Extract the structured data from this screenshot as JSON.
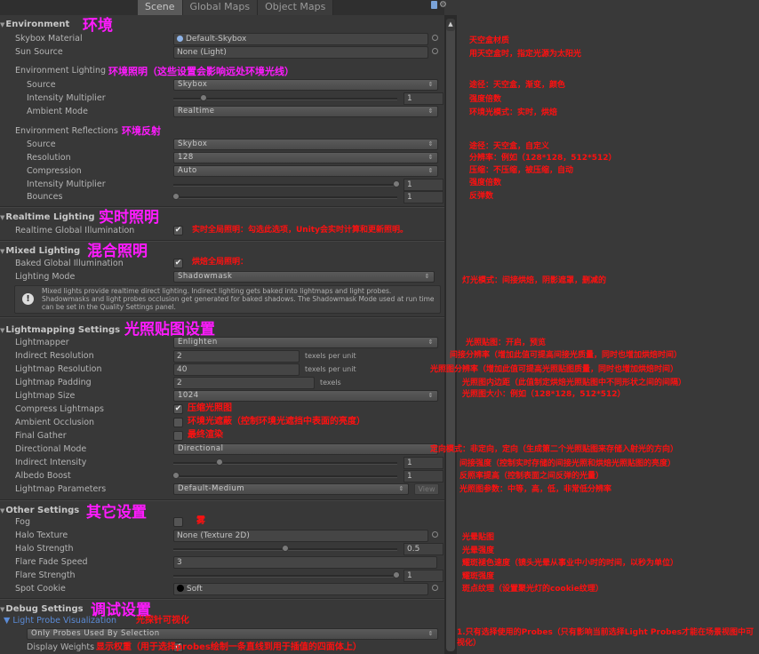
{
  "toolbar": {
    "tabs": [
      {
        "label": "Scene",
        "active": true
      },
      {
        "label": "Global Maps",
        "active": false
      },
      {
        "label": "Object Maps",
        "active": false
      }
    ],
    "icons": [
      "help-icon",
      "settings-gear-icon"
    ]
  },
  "environment": {
    "header": "Environment",
    "annotation": "环境",
    "skybox_material": {
      "label": "Skybox Material",
      "value": "Default-Skybox",
      "note": "天空盒材质"
    },
    "sun_source": {
      "label": "Sun Source",
      "value": "None (Light)",
      "note": "用天空盒时，指定光源为太阳光"
    },
    "env_lighting": {
      "label": "Environment Lighting",
      "annotation": "环境照明（这些设置会影响远处环境光线）"
    },
    "source": {
      "label": "Source",
      "value": "Skybox",
      "note": "途径：天空盒，渐变，颜色"
    },
    "intensity": {
      "label": "Intensity Multiplier",
      "value": "1",
      "slider_fraction": 0.05,
      "note": "强度倍数"
    },
    "ambient_mode": {
      "label": "Ambient Mode",
      "value": "Realtime",
      "note": "环境光模式：实时，烘焙"
    },
    "env_reflections": {
      "label": "Environment Reflections",
      "annotation": "环境反射"
    },
    "refl_source": {
      "label": "Source",
      "value": "Skybox",
      "note": "途径：天空盒，自定义"
    },
    "resolution": {
      "label": "Resolution",
      "value": "128",
      "note": "分辨率：例如（128*128，512*512）"
    },
    "compression": {
      "label": "Compression",
      "value": "Auto",
      "note": "压缩：不压缩，被压缩，自动"
    },
    "refl_intensity": {
      "label": "Intensity Multiplier",
      "value": "1",
      "slider_fraction": 1.0,
      "note": "强度倍数"
    },
    "bounces": {
      "label": "Bounces",
      "value": "1",
      "slider_fraction": 0.0,
      "note": "反弹数"
    }
  },
  "realtime": {
    "header": "Realtime Lighting",
    "annotation": "实时照明",
    "gi": {
      "label": "Realtime Global Illumination",
      "checked": true,
      "note": "实时全局照明：勾选此选项，Unity会实时计算和更新照明。"
    }
  },
  "mixed": {
    "header": "Mixed Lighting",
    "annotation": "混合照明",
    "baked_gi": {
      "label": "Baked Global Illumination",
      "checked": true,
      "note": "烘焙全局照明："
    },
    "mode": {
      "label": "Lighting Mode",
      "value": "Shadowmask",
      "note": "灯光模式：间接烘焙，阴影遮罩，删减的"
    },
    "help_text": "Mixed lights provide realtime direct lighting. Indirect lighting gets baked into lightmaps and light probes. Shadowmasks and light probes occlusion get generated for baked shadows. The Shadowmask Mode used at run time can be set in the Quality Settings panel."
  },
  "lightmapping": {
    "header": "Lightmapping Settings",
    "annotation": "光照贴图设置",
    "lightmapper": {
      "label": "Lightmapper",
      "value": "Enlighten",
      "note": "光照贴图：开启，预览"
    },
    "indirect_res": {
      "label": "Indirect Resolution",
      "value": "2",
      "unit": "texels per unit",
      "note": "间接分辨率（增加此值可提高间接光质量，同时也增加烘焙时间）"
    },
    "lightmap_res": {
      "label": "Lightmap Resolution",
      "value": "40",
      "unit": "texels per unit",
      "note": "光照图分辨率（增加此值可提高光照贴图质量，同时也增加烘焙时间）"
    },
    "padding": {
      "label": "Lightmap Padding",
      "value": "2",
      "unit": "texels",
      "note": "光照图内边距（此值制定烘焙光照贴图中不同形状之间的间隔）"
    },
    "size": {
      "label": "Lightmap Size",
      "value": "1024",
      "note": "光照图大小：例如（128*128，512*512）"
    },
    "compress": {
      "label": "Compress Lightmaps",
      "checked": true,
      "note": "压缩光照图"
    },
    "ao": {
      "label": "Ambient Occlusion",
      "checked": false,
      "note": "环境光遮蔽（控制环境光遮挡中表面的亮度）"
    },
    "final_gather": {
      "label": "Final Gather",
      "checked": false,
      "note": "最终渲染"
    },
    "directional": {
      "label": "Directional Mode",
      "value": "Directional",
      "note": "定向模式：非定向，定向（生成第二个光照贴图来存储入射光的方向）"
    },
    "indirect_intensity": {
      "label": "Indirect Intensity",
      "value": "1",
      "slider_fraction": 0.2,
      "note": "间接强度（控制实时存储的间接光照和烘焙光照贴图的亮度）"
    },
    "albedo": {
      "label": "Albedo Boost",
      "value": "1",
      "slider_fraction": 0.0,
      "note": "反照率提高（控制表面之间反弹的光量）"
    },
    "params": {
      "label": "Lightmap Parameters",
      "value": "Default-Medium",
      "button": "View",
      "note": "光照图参数：中等，高，低，非常低分辨率"
    }
  },
  "other": {
    "header": "Other Settings",
    "annotation": "其它设置",
    "fog": {
      "label": "Fog",
      "checked": false,
      "note": "雾"
    },
    "halo_texture": {
      "label": "Halo Texture",
      "value": "None (Texture 2D)",
      "note": "光晕贴图"
    },
    "halo_strength": {
      "label": "Halo Strength",
      "value": "0.5",
      "slider_fraction": 0.5,
      "note": "光晕强度"
    },
    "flare_fade": {
      "label": "Flare Fade Speed",
      "value": "3",
      "note": "耀斑褪色速度（镜头光晕从事业中小时的时间，以秒为单位）"
    },
    "flare_strength": {
      "label": "Flare Strength",
      "value": "1",
      "slider_fraction": 1.0,
      "note": "耀斑强度"
    },
    "spot_cookie": {
      "label": "Spot Cookie",
      "value": "Soft",
      "note": "斑点纹理（设置聚光灯的cookie纹理）"
    }
  },
  "debug": {
    "header": "Debug Settings",
    "annotation": "调试设置",
    "probe_vis": {
      "label": "Light Probe Visualization",
      "note": "光探针可视化"
    },
    "probe_mode": {
      "value": "Only Probes Used By Selection",
      "note": "1.只有选择使用的Probes（只有影响当前选择Light Probes才能在场景视图中可视化）"
    },
    "display_weights": {
      "label": "Display Weights",
      "checked": true,
      "note": "显示权重（用于选择probes绘制一条直线到用于插值的四面体上）"
    }
  }
}
